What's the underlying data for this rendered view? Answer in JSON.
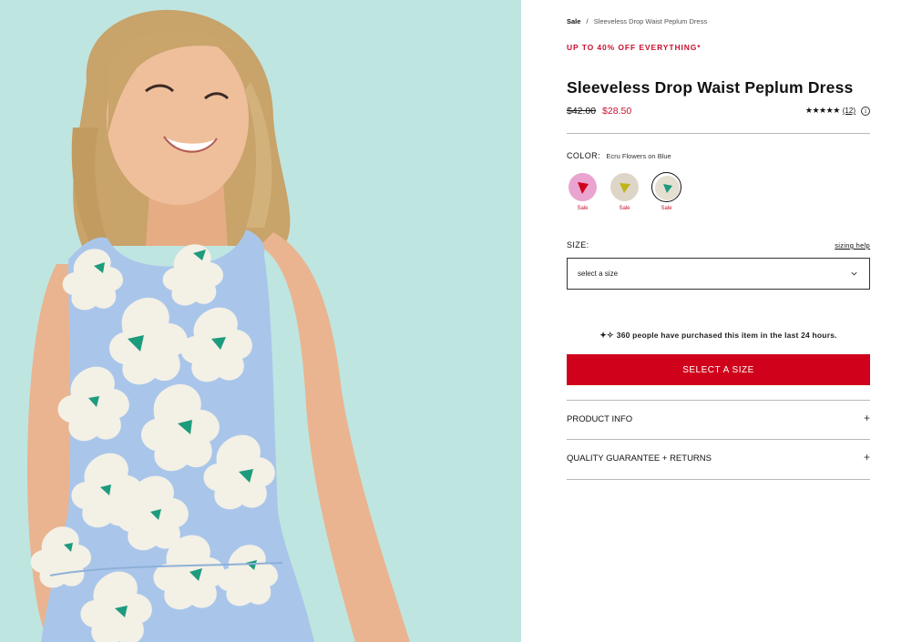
{
  "product_image": {
    "background": "#bfe5e1",
    "dress_color": "#a9c6ea",
    "flower_color": "#f3f0e6",
    "flower_center_color": "#1d9b7d"
  },
  "breadcrumb": {
    "category": "Sale",
    "separator": "/",
    "current": "Sleeveless Drop Waist Peplum Dress"
  },
  "promo_banner": "UP TO 40% OFF EVERYTHING*",
  "product": {
    "title": "Sleeveless Drop Waist Peplum Dress",
    "original_price": "$42.00",
    "sale_price": "$28.50",
    "rating_stars": "★★★★★",
    "review_count": "(12)",
    "info_icon": "i"
  },
  "color": {
    "label": "COLOR:",
    "selected": "Ecru Flowers on Blue",
    "swatches": [
      {
        "sale_label": "Sale",
        "bg": "#e9a5cf",
        "accent": "#d0021b"
      },
      {
        "sale_label": "Sale",
        "bg": "#ddd6c8",
        "accent": "#c1b41a"
      },
      {
        "sale_label": "Sale",
        "bg": "#e4dfd1",
        "accent": "#1d9b7d",
        "selected": true
      }
    ]
  },
  "size": {
    "label": "SIZE:",
    "help_link": "sizing help",
    "placeholder": "select a size"
  },
  "social_proof": {
    "icon": "sparkle-icon",
    "text": "360 people have purchased this item in the last 24 hours."
  },
  "cta": {
    "label": "SELECT A SIZE",
    "color": "#d0021b"
  },
  "accordions": [
    {
      "label": "PRODUCT INFO",
      "icon": "+"
    },
    {
      "label": "QUALITY GUARANTEE + RETURNS",
      "icon": "+"
    }
  ]
}
